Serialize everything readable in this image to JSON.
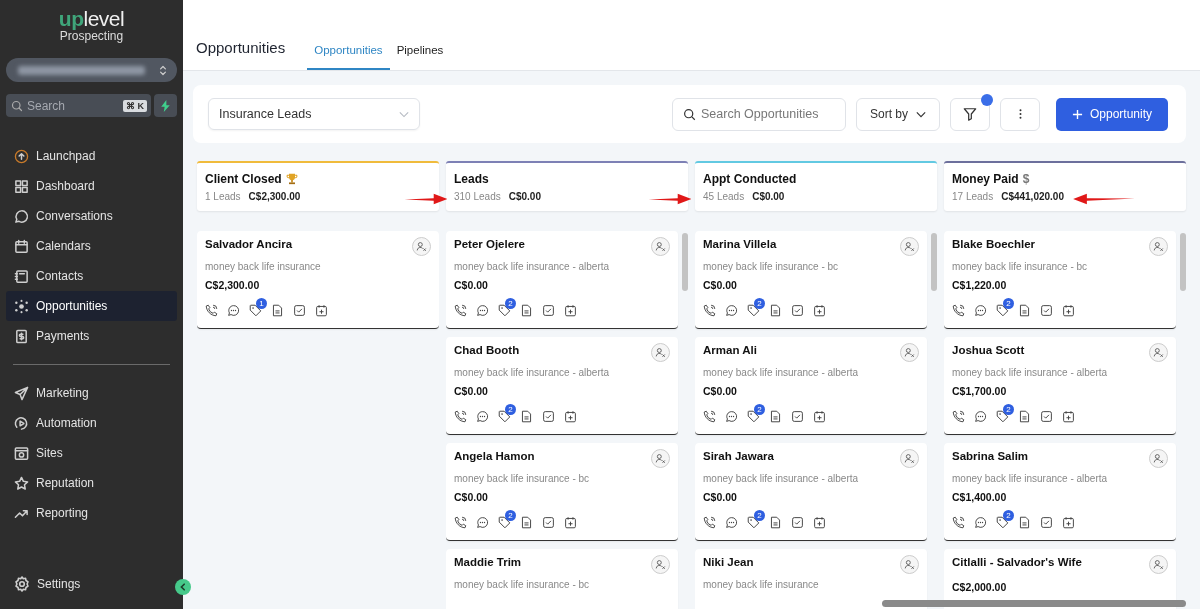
{
  "sidebar": {
    "logo": {
      "brand_left": "up",
      "brand_right": "level",
      "subtitle": "Prospecting"
    },
    "search": {
      "placeholder": "Search",
      "shortcut": "⌘ K"
    },
    "nav_primary": [
      {
        "label": "Launchpad",
        "selected": false
      },
      {
        "label": "Dashboard",
        "selected": false
      },
      {
        "label": "Conversations",
        "selected": false
      },
      {
        "label": "Calendars",
        "selected": false
      },
      {
        "label": "Contacts",
        "selected": false
      },
      {
        "label": "Opportunities",
        "selected": true
      },
      {
        "label": "Payments",
        "selected": false
      }
    ],
    "nav_secondary": [
      {
        "label": "Marketing",
        "selected": false
      },
      {
        "label": "Automation",
        "selected": false
      },
      {
        "label": "Sites",
        "selected": false
      },
      {
        "label": "Reputation",
        "selected": false
      },
      {
        "label": "Reporting",
        "selected": false
      }
    ],
    "settings": {
      "label": "Settings"
    }
  },
  "header": {
    "title": "Opportunities",
    "tabs": [
      {
        "label": "Opportunities",
        "selected": true
      },
      {
        "label": "Pipelines",
        "selected": false
      }
    ]
  },
  "toolbar": {
    "pipeline": "Insurance Leads",
    "search": {
      "placeholder": "Search Opportunities"
    },
    "sort": "Sort by",
    "filter": {
      "indicator": true
    },
    "add_button": "Opportunity"
  },
  "columns": [
    {
      "title": "Client Closed",
      "kind": "trophy",
      "color": "#f0bb3c",
      "count": "1 Leads",
      "total": "C$2,300.00",
      "scrollbar": false,
      "cards": [
        {
          "name": "Salvador Ancira",
          "subtitle": "money back life insurance",
          "amount": "C$2,300.00",
          "tag_count": "1"
        }
      ]
    },
    {
      "title": "Leads",
      "kind": "plain",
      "color": "#7d80b5",
      "count": "310 Leads",
      "total": "C$0.00",
      "scrollbar": true,
      "cards": [
        {
          "name": "Peter Ojelere",
          "subtitle": "money back life insurance - alberta",
          "amount": "C$0.00",
          "tag_count": "2"
        },
        {
          "name": "Chad Booth",
          "subtitle": "money back life insurance - alberta",
          "amount": "C$0.00",
          "tag_count": "2"
        },
        {
          "name": "Angela Hamon",
          "subtitle": "money back life insurance - bc",
          "amount": "C$0.00",
          "tag_count": "2"
        },
        {
          "name": "Maddie Trim",
          "subtitle": "money back life insurance - bc"
        }
      ]
    },
    {
      "title": "Appt Conducted",
      "kind": "plain",
      "color": "#62c9e2",
      "count": "45 Leads",
      "total": "C$0.00",
      "scrollbar": true,
      "cards": [
        {
          "name": "Marina Villela",
          "subtitle": "money back life insurance - bc",
          "amount": "C$0.00",
          "tag_count": "2"
        },
        {
          "name": "Arman Ali",
          "subtitle": "money back life insurance - alberta",
          "amount": "C$0.00",
          "tag_count": "2"
        },
        {
          "name": "Sirah Jawara",
          "subtitle": "money back life insurance - alberta",
          "amount": "C$0.00",
          "tag_count": "2"
        },
        {
          "name": "Niki Jean",
          "subtitle": "money back life insurance"
        }
      ]
    },
    {
      "title": "Money Paid",
      "kind": "plain",
      "symbol": "$",
      "color": "#6c6f9c",
      "count": "17 Leads",
      "total": "C$441,020.00",
      "scrollbar": true,
      "cards": [
        {
          "name": "Blake Boechler",
          "subtitle": "money back life insurance - bc",
          "amount": "C$1,220.00",
          "tag_count": "2"
        },
        {
          "name": "Joshua Scott",
          "subtitle": "money back life insurance - alberta",
          "amount": "C$1,700.00",
          "tag_count": "2"
        },
        {
          "name": "Sabrina Salim",
          "subtitle": "money back life insurance - alberta",
          "amount": "C$1,400.00",
          "tag_count": "2"
        },
        {
          "name": "Citlalli - Salvador's Wife",
          "amount": "C$2,000.00"
        }
      ]
    }
  ]
}
